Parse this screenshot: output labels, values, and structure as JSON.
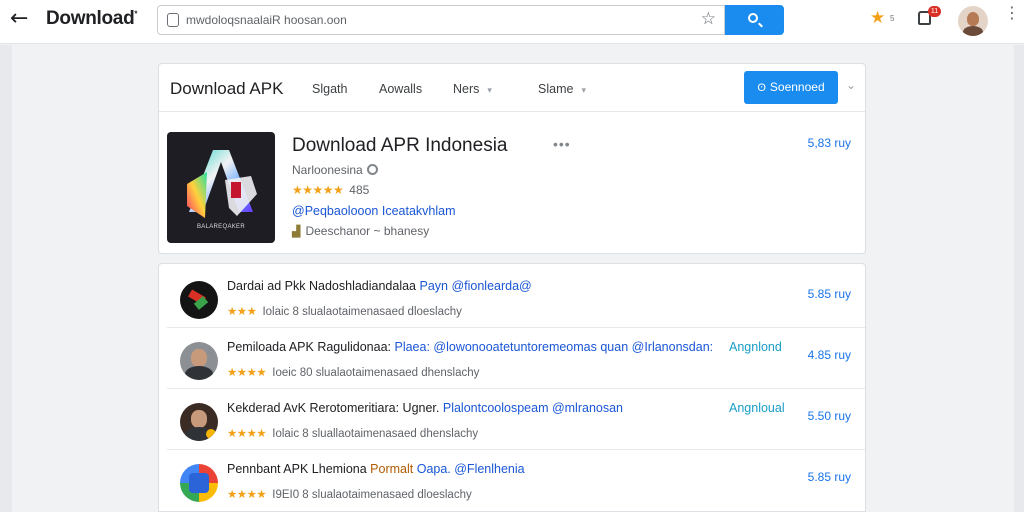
{
  "header": {
    "title": "Download",
    "title_sup": "*",
    "url": "mwdoloqsnaalaiR hoosan.oon",
    "star_count": "5",
    "notif_badge": "11"
  },
  "nav": {
    "title": "Download APK",
    "items": [
      {
        "label": "Slgath",
        "chev": ""
      },
      {
        "label": "Aowalls",
        "chev": ""
      },
      {
        "label": "Ners",
        "chev": "▾"
      },
      {
        "label": "Slame",
        "chev": "▾"
      }
    ],
    "primary_btn": "Soennoed",
    "primary_btn_icon": "ʘ"
  },
  "app": {
    "name": "Download APR Indonesia",
    "developer": "Narloonesina",
    "stars": "★★★★★",
    "rating_count": "485",
    "tag": "@Peqbaolooon Iceatakvhlam",
    "desc": "Deeschanor ~ bhanesy",
    "price": "5,83 ruy",
    "logo_text": "BALAREQAKER",
    "more": "•••"
  },
  "list": [
    {
      "t1": "Dardai ad Pkk Nadoshladiandalaa",
      "t2": " Payn @fionlearda@",
      "t2class": "lk",
      "tag": "",
      "stars": "★★★",
      "meta": "Iolaic 8 slualaotaimenasaed dloeslachy",
      "price": "5.85 ruy"
    },
    {
      "t1": "Pemiloada APK Ragulidonaa: ",
      "t2": "Plaea: @lowonooatetuntoremeomas quan @Irlanonsdan:",
      "t2class": "lk",
      "tag": "Angnlond",
      "stars": "★★★★",
      "meta": "Ioeic 80 slualaotaimenasaed dhenslachy",
      "price": "4.85 ruy"
    },
    {
      "t1": "Kekderad AvK Rerotomeritiara: Ugner. ",
      "t2": "Plalontcoolospeam @mlranosan",
      "t2class": "lk",
      "tag": "Angnloual",
      "stars": "★★★★",
      "meta": "Iolaic 8 sluallaotaimenasaed dhenslachy",
      "price": "5.50 ruy"
    },
    {
      "t1": "Pennbant APK Lhemiona ",
      "t2": "Pormalt",
      "t2class": "or",
      "t3": " Oapa. @Flenlhenia",
      "tag": "",
      "stars": "★★★★",
      "meta": "I9EI0 8 slualaotaimenasaed dloeslachy",
      "price": "5.85 ruy"
    }
  ],
  "colors": {
    "accent": "#1a8cf0",
    "star": "#f4a11a",
    "link": "#1a56d6"
  }
}
